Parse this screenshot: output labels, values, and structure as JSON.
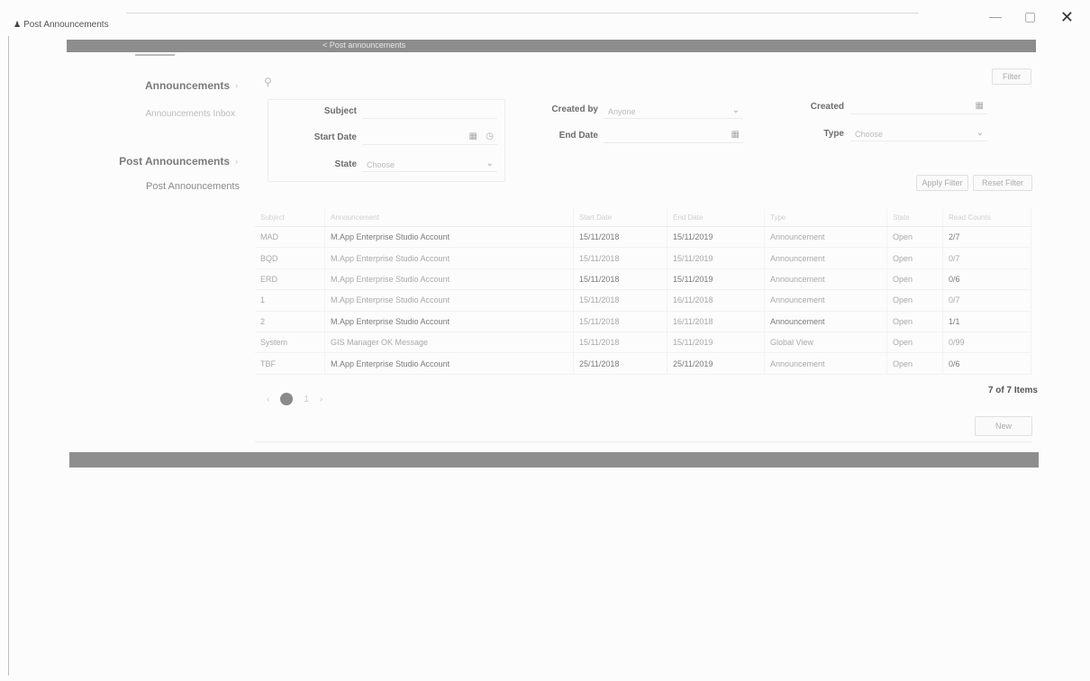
{
  "window": {
    "title": "Post Announcements",
    "minimize_glyph": "—",
    "maximize_glyph": "▢",
    "close_glyph": "✕",
    "app_icon": "person-icon"
  },
  "topbar": {
    "label": "< Post announcements"
  },
  "sidebar": {
    "section1": {
      "heading": "Announcements",
      "link": "Announcements Inbox"
    },
    "section2": {
      "heading": "Post Announcements",
      "link": "Post Announcements"
    }
  },
  "toolbar": {
    "filter_label": "Filter",
    "apply_filters_label": "Apply Filter",
    "reset_filters_label": "Reset Filter",
    "new_label": "New"
  },
  "search": {
    "subject": {
      "label": "Subject",
      "value": ""
    },
    "start_date": {
      "label": "Start Date",
      "value": ""
    },
    "state": {
      "label": "State",
      "value": "Choose"
    },
    "created_by": {
      "label": "Created by",
      "value": "Anyone"
    },
    "end_date": {
      "label": "End Date",
      "value": ""
    },
    "created": {
      "label": "Created",
      "value": ""
    },
    "type": {
      "label": "Type",
      "value": "Choose"
    }
  },
  "table": {
    "headers": [
      "Subject",
      "Announcement",
      "Start Date",
      "End Date",
      "Type",
      "State",
      "Read Counts"
    ],
    "rows": [
      [
        "MAD",
        "M.App Enterprise Studio Account",
        "15/11/2018",
        "15/11/2019",
        "Announcement",
        "Open",
        "2/7"
      ],
      [
        "BQD",
        "M.App Enterprise Studio Account",
        "15/11/2018",
        "15/11/2019",
        "Announcement",
        "Open",
        "0/7"
      ],
      [
        "ERD",
        "M.App Enterprise Studio Account",
        "15/11/2018",
        "15/11/2019",
        "Announcement",
        "Open",
        "0/6"
      ],
      [
        "1",
        "M.App Enterprise Studio Account",
        "15/11/2018",
        "16/11/2018",
        "Announcement",
        "Open",
        "0/7"
      ],
      [
        "2",
        "M.App Enterprise Studio Account",
        "15/11/2018",
        "16/11/2018",
        "Announcement",
        "Open",
        "1/1"
      ],
      [
        "System",
        "GIS Manager OK Message",
        "15/11/2018",
        "15/11/2019",
        "Global View",
        "Open",
        "0/99"
      ],
      [
        "TBF",
        "M.App Enterprise Studio Account",
        "25/11/2018",
        "25/11/2019",
        "Announcement",
        "Open",
        "0/6"
      ]
    ]
  },
  "pagination": {
    "prev": "‹",
    "next": "›",
    "current": "1",
    "items_label": "7 of 7 Items"
  }
}
